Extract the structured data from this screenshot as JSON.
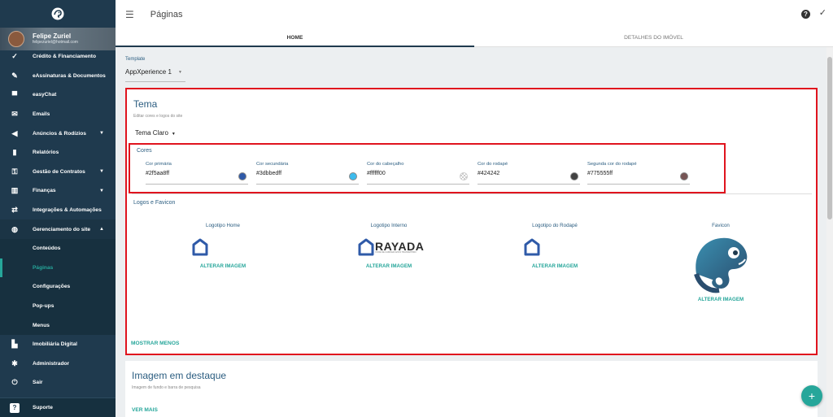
{
  "sidebar": {
    "user": {
      "name": "Felipe Zuriel",
      "email": "felipezuriel@hotmail.com"
    },
    "items": [
      {
        "label": "Crédito & Financiamento",
        "icon": "credit-icon"
      },
      {
        "label": "eAssinaturas & Documentos",
        "icon": "signature-icon"
      },
      {
        "label": "easyChat",
        "icon": "chat-icon"
      },
      {
        "label": "Emails",
        "icon": "mail-icon"
      },
      {
        "label": "Anúncios & Rodízios",
        "icon": "megaphone-icon"
      },
      {
        "label": "Relatórios",
        "icon": "chart-icon"
      },
      {
        "label": "Gestão de Contratos",
        "icon": "key-icon"
      },
      {
        "label": "Finanças",
        "icon": "bank-icon"
      },
      {
        "label": "Integrações & Automações",
        "icon": "integration-icon"
      },
      {
        "label": "Gerenciamento do site",
        "icon": "globe-icon"
      }
    ],
    "subitems": [
      "Conteúdos",
      "Páginas",
      "Configurações",
      "Pop-ups",
      "Menus"
    ],
    "bottom_items": [
      {
        "label": "Imobiliária Digital",
        "icon": "building-icon"
      },
      {
        "label": "Administrador",
        "icon": "gear-icon"
      },
      {
        "label": "Sair",
        "icon": "power-icon"
      }
    ],
    "support": "Suporte"
  },
  "header": {
    "title": "Páginas"
  },
  "tabs": [
    "HOME",
    "DETALHES DO IMÓVEL"
  ],
  "template": {
    "label": "Template",
    "value": "AppXperience 1"
  },
  "tema": {
    "title": "Tema",
    "subtitle": "Editar cores e logos do site",
    "theme_value": "Tema Claro",
    "cores_title": "Cores",
    "colors": [
      {
        "label": "Cor primária",
        "value": "#2f5aa8ff",
        "swatch": "#2f5aa8"
      },
      {
        "label": "Cor secundária",
        "value": "#3dbbedff",
        "swatch": "#3dbbed"
      },
      {
        "label": "Cor do cabeçalho",
        "value": "#ffffff00",
        "swatch": "transparent"
      },
      {
        "label": "Cor do rodapé",
        "value": "#424242",
        "swatch": "#424242"
      },
      {
        "label": "Segunda cor do rodapé",
        "value": "#775555ff",
        "swatch": "#775555"
      }
    ],
    "logos_title": "Logos e Favicon",
    "logos": [
      {
        "label": "Logotipo Home",
        "change": "ALTERAR IMAGEM"
      },
      {
        "label": "Logotipo Interno",
        "change": "ALTERAR IMAGEM",
        "brand": "RAYADA",
        "tagline": "VOCÊ DE CAMINHO ESTÁ TRANSMITIDO"
      },
      {
        "label": "Logotipo do Rodapé",
        "change": "ALTERAR IMAGEM"
      },
      {
        "label": "Favicon",
        "change": "ALTERAR IMAGEM"
      }
    ],
    "toggle_label": "MOSTRAR MENOS"
  },
  "imagem": {
    "title": "Imagem em destaque",
    "subtitle": "Imagem de fundo e barra de pesquisa",
    "more_label": "VER MAIS"
  },
  "colors": {
    "sidebar_bg": "#1f3a4e",
    "accent": "#26a69a",
    "heading": "#2b5d80",
    "highlight": "#e0141e"
  }
}
